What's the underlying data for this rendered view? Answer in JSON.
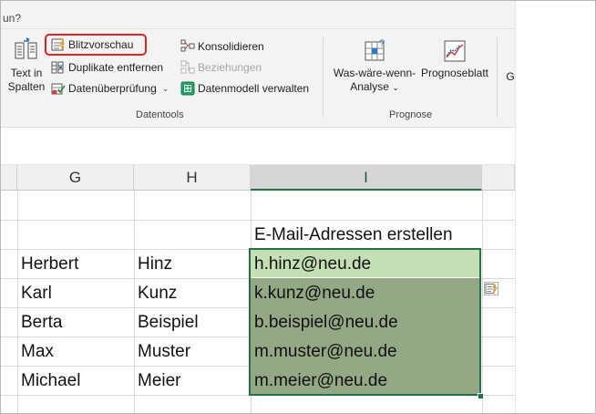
{
  "ribbon": {
    "tab_hint": "un?",
    "datentools": {
      "label": "Datentools",
      "text_in_spalten": [
        "Text in",
        "Spalten"
      ],
      "blitzvorschau": "Blitzvorschau",
      "duplikate_entfernen": "Duplikate entfernen",
      "datenueberpruefung": "Datenüberprüfung",
      "konsolidieren": "Konsolidieren",
      "beziehungen": "Beziehungen",
      "datenmodell_verwalten": "Datenmodell verwalten"
    },
    "prognose": {
      "label": "Prognose",
      "was_waere_wenn": [
        "Was-wäre-wenn-",
        "Analyse"
      ],
      "prognoseblatt": "Prognoseblatt"
    },
    "cut_label": "G"
  },
  "sheet": {
    "columns": [
      "G",
      "H",
      "I"
    ],
    "selected_column": "I",
    "header_cell": "E-Mail-Adressen erstellen",
    "rows": [
      {
        "first": "Herbert",
        "last": "Hinz",
        "email": "h.hinz@neu.de"
      },
      {
        "first": "Karl",
        "last": "Kunz",
        "email": "k.kunz@neu.de"
      },
      {
        "first": "Berta",
        "last": "Beispiel",
        "email": "b.beispiel@neu.de"
      },
      {
        "first": "Max",
        "last": "Muster",
        "email": "m.muster@neu.de"
      },
      {
        "first": "Michael",
        "last": "Meier",
        "email": "m.meier@neu.de"
      }
    ]
  },
  "colors": {
    "excel_green": "#217346",
    "highlight_red": "#e02424",
    "active_cell_fill": "#c5dfb4",
    "selection_fill": "#93a884"
  }
}
